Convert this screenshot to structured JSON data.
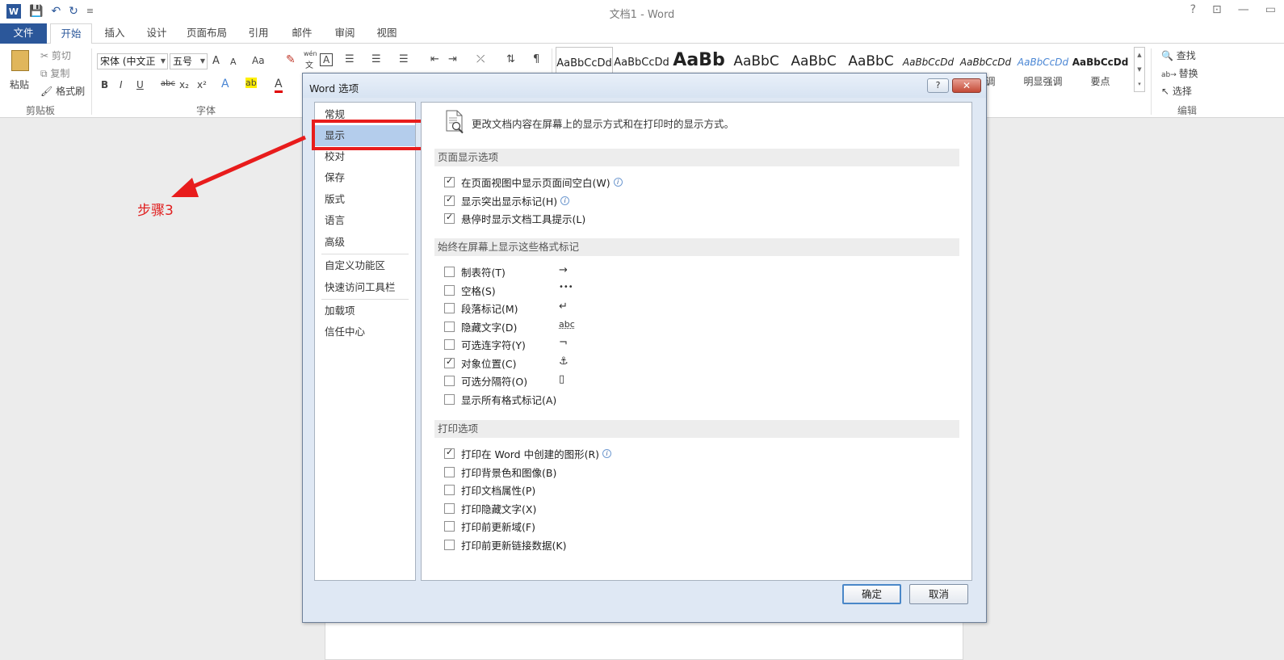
{
  "window": {
    "title": "文档1 - Word",
    "controls": [
      "?",
      "⊡",
      "—",
      "▭"
    ]
  },
  "qat": [
    "W",
    "💾",
    "↶",
    "↻",
    "≡"
  ],
  "tabs": [
    "文件",
    "开始",
    "插入",
    "设计",
    "页面布局",
    "引用",
    "邮件",
    "审阅",
    "视图"
  ],
  "ribbon": {
    "clipboard": {
      "paste": "粘贴",
      "cut": "剪切",
      "copy": "复制",
      "format_painter": "格式刷",
      "label": "剪贴板"
    },
    "font": {
      "font_name": "宋体 (中文正",
      "font_size": "五号",
      "label": "字体",
      "grow": "A",
      "shrink": "A",
      "case": "Aa",
      "bold": "B",
      "italic": "I",
      "underline": "U",
      "strike": "abc",
      "sub": "x₂",
      "sup": "x²",
      "effects": "A",
      "highlight": "ab",
      "color": "A",
      "phonetic_top": "wén",
      "phonetic_bottom": "文",
      "charborder": "A"
    },
    "styles": [
      {
        "sample": "AaBbCcDd",
        "name": ""
      },
      {
        "sample": "AaBbCcDd",
        "name": ""
      },
      {
        "sample": "AaBb",
        "name": ""
      },
      {
        "sample": "AaBbC",
        "name": ""
      },
      {
        "sample": "AaBbC",
        "name": ""
      },
      {
        "sample": "AaBbC",
        "name": ""
      },
      {
        "sample": "AaBbCcDd",
        "name": ""
      },
      {
        "sample": "AaBbCcDd",
        "name": "强调"
      },
      {
        "sample": "AaBbCcDd",
        "name": "明显强调"
      },
      {
        "sample": "AaBbCcDd",
        "name": "要点"
      }
    ],
    "editing": {
      "find": "查找",
      "replace": "替换",
      "select": "选择",
      "label": "编辑"
    }
  },
  "annotation": {
    "step": "步骤3"
  },
  "dialog": {
    "title": "Word 选项",
    "help": "?",
    "close": "✕",
    "nav": [
      "常规",
      "显示",
      "校对",
      "保存",
      "版式",
      "语言",
      "高级",
      "自定义功能区",
      "快速访问工具栏",
      "加载项",
      "信任中心"
    ],
    "selected_nav": "显示",
    "description": "更改文档内容在屏幕上的显示方式和在打印时的显示方式。",
    "sections": [
      {
        "title": "页面显示选项",
        "options": [
          {
            "label": "在页面视图中显示页面间空白(W)",
            "checked": true,
            "info": true
          },
          {
            "label": "显示突出显示标记(H)",
            "checked": true,
            "info": true
          },
          {
            "label": "悬停时显示文档工具提示(L)",
            "checked": true,
            "info": false
          }
        ]
      },
      {
        "title": "始终在屏幕上显示这些格式标记",
        "options": [
          {
            "label": "制表符(T)",
            "checked": false,
            "mark": "→"
          },
          {
            "label": "空格(S)",
            "checked": false,
            "mark": "•••"
          },
          {
            "label": "段落标记(M)",
            "checked": false,
            "mark": "↵"
          },
          {
            "label": "隐藏文字(D)",
            "checked": false,
            "mark": "abc"
          },
          {
            "label": "可选连字符(Y)",
            "checked": false,
            "mark": "¬"
          },
          {
            "label": "对象位置(C)",
            "checked": true,
            "mark": "⚓"
          },
          {
            "label": "可选分隔符(O)",
            "checked": false,
            "mark": "▯"
          },
          {
            "label": "显示所有格式标记(A)",
            "checked": false,
            "mark": ""
          }
        ]
      },
      {
        "title": "打印选项",
        "options": [
          {
            "label": "打印在 Word 中创建的图形(R)",
            "checked": true,
            "info": true
          },
          {
            "label": "打印背景色和图像(B)",
            "checked": false
          },
          {
            "label": "打印文档属性(P)",
            "checked": false
          },
          {
            "label": "打印隐藏文字(X)",
            "checked": false
          },
          {
            "label": "打印前更新域(F)",
            "checked": false
          },
          {
            "label": "打印前更新链接数据(K)",
            "checked": false
          }
        ]
      }
    ],
    "ok": "确定",
    "cancel": "取消"
  },
  "colors": {
    "accent": "#2b579a",
    "annotation": "#e81c1c",
    "nav_selected": "#b4cdec"
  }
}
